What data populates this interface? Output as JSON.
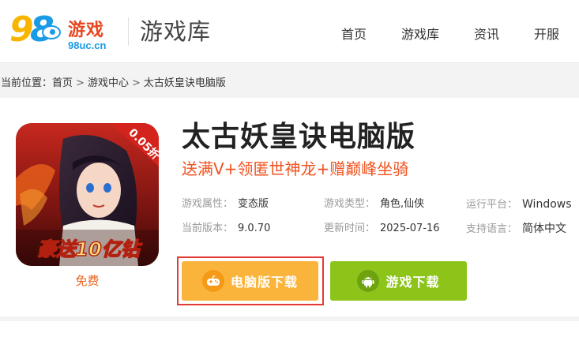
{
  "header": {
    "logo_brand": "游戏",
    "logo_domain": "98uc.cn",
    "logo_number_a": "9",
    "logo_number_b": "8",
    "section_title": "游戏库",
    "nav": [
      "首页",
      "游戏库",
      "资讯",
      "开服"
    ]
  },
  "breadcrumb": {
    "prefix": "当前位置：",
    "items": [
      "首页",
      "游戏中心",
      "太古妖皇诀电脑版"
    ],
    "separator": ">"
  },
  "game": {
    "title": "太古妖皇诀电脑版",
    "promo": "送满V+领匿世神龙+赠巅峰坐骑",
    "price_label": "免费",
    "icon_badge": "0.05折",
    "icon_caption": "豪送10亿钻",
    "info": {
      "attr_label": "游戏属性：",
      "attr_value": "变态版",
      "type_label": "游戏类型：",
      "type_value": "角色,仙侠",
      "platform_label": "运行平台：",
      "platform_value": "Windows",
      "version_label": "当前版本：",
      "version_value": "9.0.70",
      "updated_label": "更新时间：",
      "updated_value": "2025-07-16",
      "lang_label": "支持语言：",
      "lang_value": "简体中文"
    },
    "buttons": {
      "pc_download": "电脑版下载",
      "game_download": "游戏下载"
    }
  },
  "colors": {
    "accent_orange": "#fbb43b",
    "accent_green": "#8cc41a",
    "promo_red": "#f0521f",
    "highlight": "#e53935"
  }
}
